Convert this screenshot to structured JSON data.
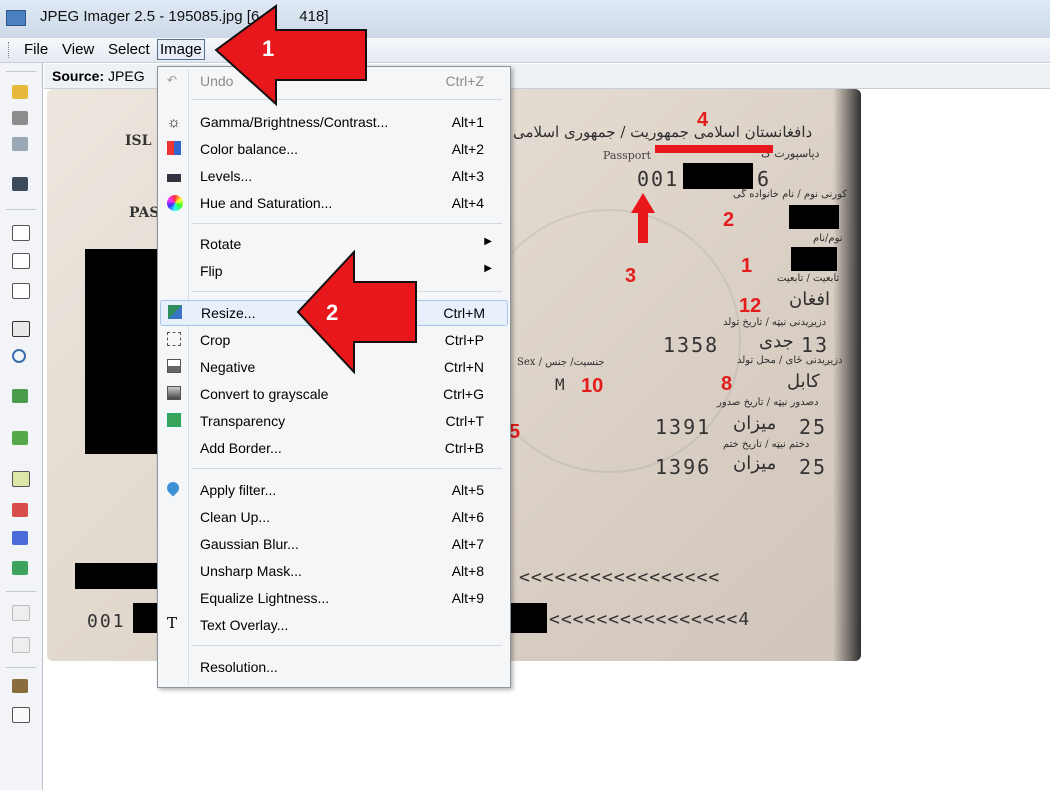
{
  "window": {
    "title": "JPEG Imager 2.5 - 195085.jpg [6",
    "title_tail": "418]"
  },
  "menubar": {
    "items": [
      "File",
      "View",
      "Select",
      "Image"
    ]
  },
  "sourcebar": {
    "label_bold": "Source:",
    "label_rest": "JPEG"
  },
  "menu": {
    "undo": {
      "label": "Undo",
      "shortcut": "Ctrl+Z"
    },
    "gamma": {
      "label": "Gamma/Brightness/Contrast...",
      "shortcut": "Alt+1"
    },
    "color_balance": {
      "label": "Color balance...",
      "shortcut": "Alt+2"
    },
    "levels": {
      "label": "Levels...",
      "shortcut": "Alt+3"
    },
    "hue": {
      "label": "Hue and Saturation...",
      "shortcut": "Alt+4"
    },
    "rotate": {
      "label": "Rotate"
    },
    "flip": {
      "label": "Flip"
    },
    "resize": {
      "label": "Resize...",
      "shortcut": "Ctrl+M"
    },
    "crop": {
      "label": "Crop",
      "shortcut": "Ctrl+P"
    },
    "negative": {
      "label": "Negative",
      "shortcut": "Ctrl+N"
    },
    "grayscale": {
      "label": "Convert to grayscale",
      "shortcut": "Ctrl+G"
    },
    "transparency": {
      "label": "Transparency",
      "shortcut": "Ctrl+T"
    },
    "add_border": {
      "label": "Add Border...",
      "shortcut": "Ctrl+B"
    },
    "apply_filter": {
      "label": "Apply filter...",
      "shortcut": "Alt+5"
    },
    "clean_up": {
      "label": "Clean Up...",
      "shortcut": "Alt+6"
    },
    "gaussian": {
      "label": "Gaussian Blur...",
      "shortcut": "Alt+7"
    },
    "unsharp": {
      "label": "Unsharp Mask...",
      "shortcut": "Alt+8"
    },
    "equalize": {
      "label": "Equalize Lightness...",
      "shortcut": "Alt+9"
    },
    "text_overlay": {
      "label": "Text Overlay..."
    },
    "resolution": {
      "label": "Resolution..."
    }
  },
  "annotations": {
    "arrow1": "1",
    "arrow2": "2"
  },
  "passport": {
    "isl": "ISL",
    "pas": "PAS",
    "ar_title": "دافغانستان اسلامی جمهوریت / جمهوری اسلامی",
    "passport_word": "Passport",
    "ar_passport": "دپاسپورت گ",
    "num_prefix": "001",
    "num_suffix": "6",
    "ar_surname": "کورنی نوم / نام خانواده گی",
    "ar_name": "نوم/نام",
    "ar_nationality": "تابعیت / تابعیت",
    "nationality": "افغان",
    "ar_dob": "دزیږیدنی نیټه / تاریخ تولد",
    "dob_day": "13",
    "dob_month": "جدی",
    "dob_year": "1358",
    "sex_label": "Sex / جنسیت/ جنس",
    "sex": "M",
    "ar_pob": "دزیږیدنی ځای / محل تولد",
    "pob": "کابل",
    "ar_issue": "دصدور نیټه / تاریخ صدور",
    "issue_day": "25",
    "issue_month": "میزان",
    "issue_year": "1391",
    "ar_expiry": "دختم نیټه / تاریخ ختم",
    "expiry_day": "25",
    "expiry_month": "میزان",
    "expiry_year": "1396",
    "mrz1": "<<<<<<<<<<<<<<<<<",
    "mrz2_prefix": "001",
    "mrz2": "<<<<<<<<<<<<<<<<4",
    "r1": "1",
    "r2": "2",
    "r3": "3",
    "r4": "4",
    "r5": "5",
    "r8": "8",
    "r10": "10",
    "r12": "12"
  },
  "colors": {
    "arrow": "#e8171c",
    "highlight": "#e8f1fb"
  }
}
